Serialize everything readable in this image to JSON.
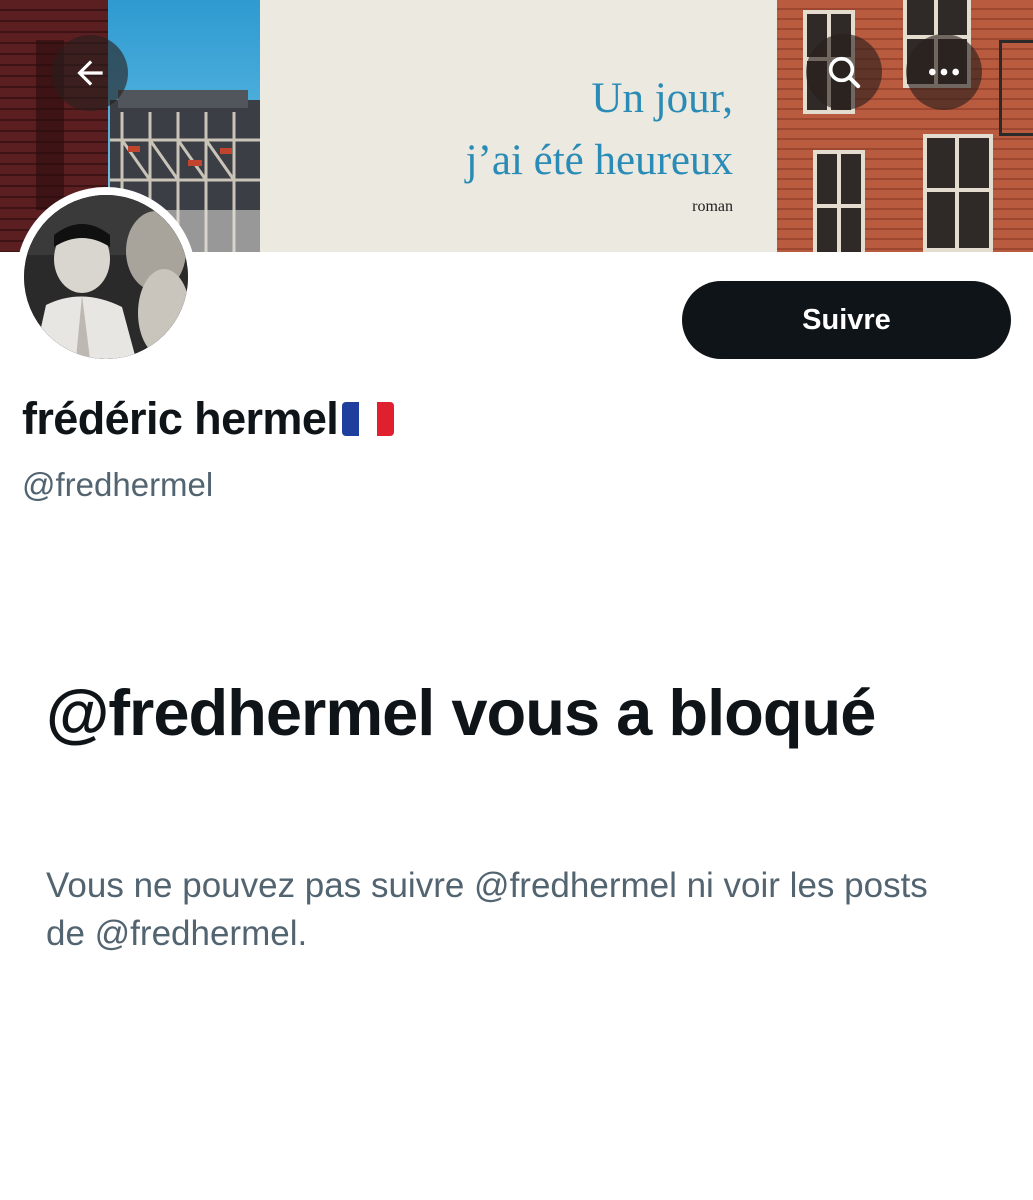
{
  "header": {
    "back_icon": "arrow-left-icon",
    "search_icon": "search-icon",
    "more_icon": "more-horizontal-icon"
  },
  "banner": {
    "book_title_line1": "Un jour,",
    "book_title_line2": "j’ai été heureux",
    "book_subtitle": "roman",
    "title_color": "#2a8cb6"
  },
  "profile": {
    "display_name": "frédéric hermel",
    "flag_emoji": "🇫🇷",
    "handle": "@fredhermel",
    "follow_label": "Suivre"
  },
  "blocked": {
    "title": "@fredhermel vous a bloqué",
    "description": "Vous ne pouvez pas suivre @fredhermel ni voir les posts de @fredhermel."
  },
  "colors": {
    "text_primary": "#0f1419",
    "text_secondary": "#536471",
    "button_bg": "#0f1419",
    "button_text": "#ffffff"
  }
}
